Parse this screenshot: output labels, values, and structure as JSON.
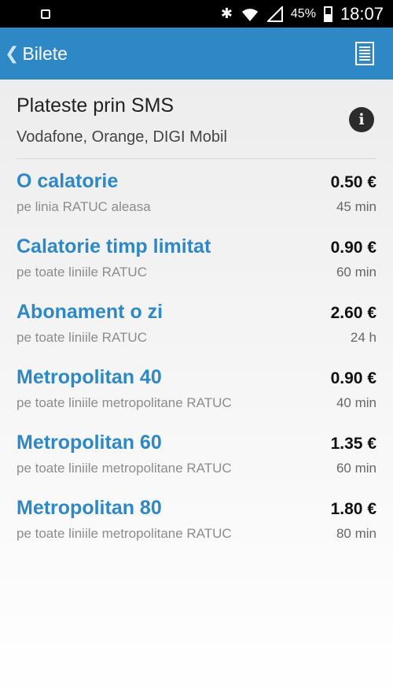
{
  "status_bar": {
    "battery_percent": "45%",
    "time": "18:07",
    "icons": [
      "smartwatch-icon",
      "bluetooth-icon",
      "wifi-icon",
      "signal-icon",
      "battery-icon"
    ]
  },
  "app_bar": {
    "back_label": "Bilete",
    "icons": [
      "back-chevron-icon",
      "document-icon"
    ]
  },
  "sms": {
    "title": "Plateste prin SMS",
    "operators": "Vodafone, Orange, DIGI Mobil",
    "icon": "info-icon"
  },
  "tickets": [
    {
      "name": "O calatorie",
      "desc": "pe linia RATUC aleasa",
      "price": "0.50 €",
      "duration": "45 min"
    },
    {
      "name": "Calatorie timp limitat",
      "desc": "pe toate liniile RATUC",
      "price": "0.90 €",
      "duration": "60 min"
    },
    {
      "name": "Abonament o zi",
      "desc": "pe toate liniile RATUC",
      "price": "2.60 €",
      "duration": "24 h"
    },
    {
      "name": "Metropolitan 40",
      "desc": "pe toate liniile metropolitane RATUC",
      "price": "0.90 €",
      "duration": "40 min"
    },
    {
      "name": "Metropolitan 60",
      "desc": "pe toate liniile metropolitane RATUC",
      "price": "1.35 €",
      "duration": "60 min"
    },
    {
      "name": "Metropolitan 80",
      "desc": "pe toate liniile metropolitane RATUC",
      "price": "1.80 €",
      "duration": "80 min"
    }
  ],
  "colors": {
    "primary": "#2e88c6",
    "status_bar": "#000000",
    "price_text": "#111111",
    "secondary_text": "#8c8c8c"
  }
}
